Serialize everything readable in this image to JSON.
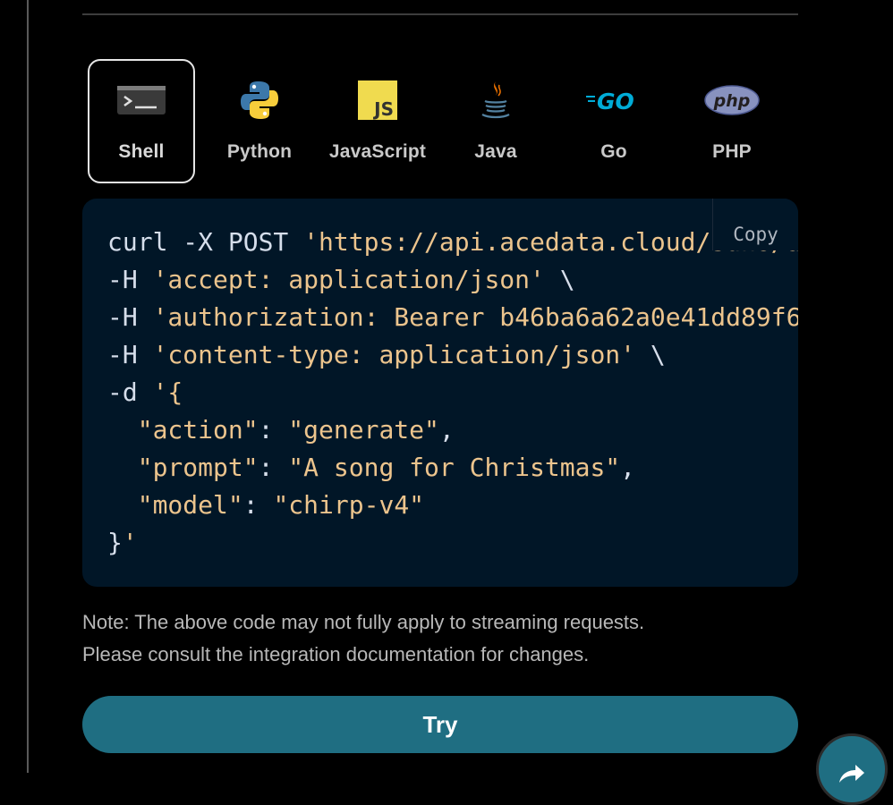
{
  "languages": [
    {
      "label": "Shell",
      "icon": "terminal-icon",
      "active": true
    },
    {
      "label": "Python",
      "icon": "python-icon",
      "active": false
    },
    {
      "label": "JavaScript",
      "icon": "javascript-icon",
      "active": false
    },
    {
      "label": "Java",
      "icon": "java-icon",
      "active": false
    },
    {
      "label": "Go",
      "icon": "go-icon",
      "active": false
    },
    {
      "label": "PHP",
      "icon": "php-icon",
      "active": false
    }
  ],
  "code": {
    "copy_label": "Copy",
    "lines": [
      "curl -X POST 'https://api.acedata.cloud/suno/a",
      "-H 'accept: application/json' \\",
      "-H 'authorization: Bearer b46ba6a62a0e41dd89f6",
      "-H 'content-type: application/json' \\",
      "-d '{",
      "  \"action\": \"generate\",",
      "  \"prompt\": \"A song for Christmas\",",
      "  \"model\": \"chirp-v4\"",
      "}'"
    ]
  },
  "note": {
    "line1": "Note: The above code may not fully apply to streaming requests.",
    "line2": "Please consult the integration documentation for changes."
  },
  "try_label": "Try",
  "colors": {
    "background": "#000000",
    "code_bg": "#011627",
    "string": "#ecc48d",
    "accent": "#1f6e82"
  }
}
